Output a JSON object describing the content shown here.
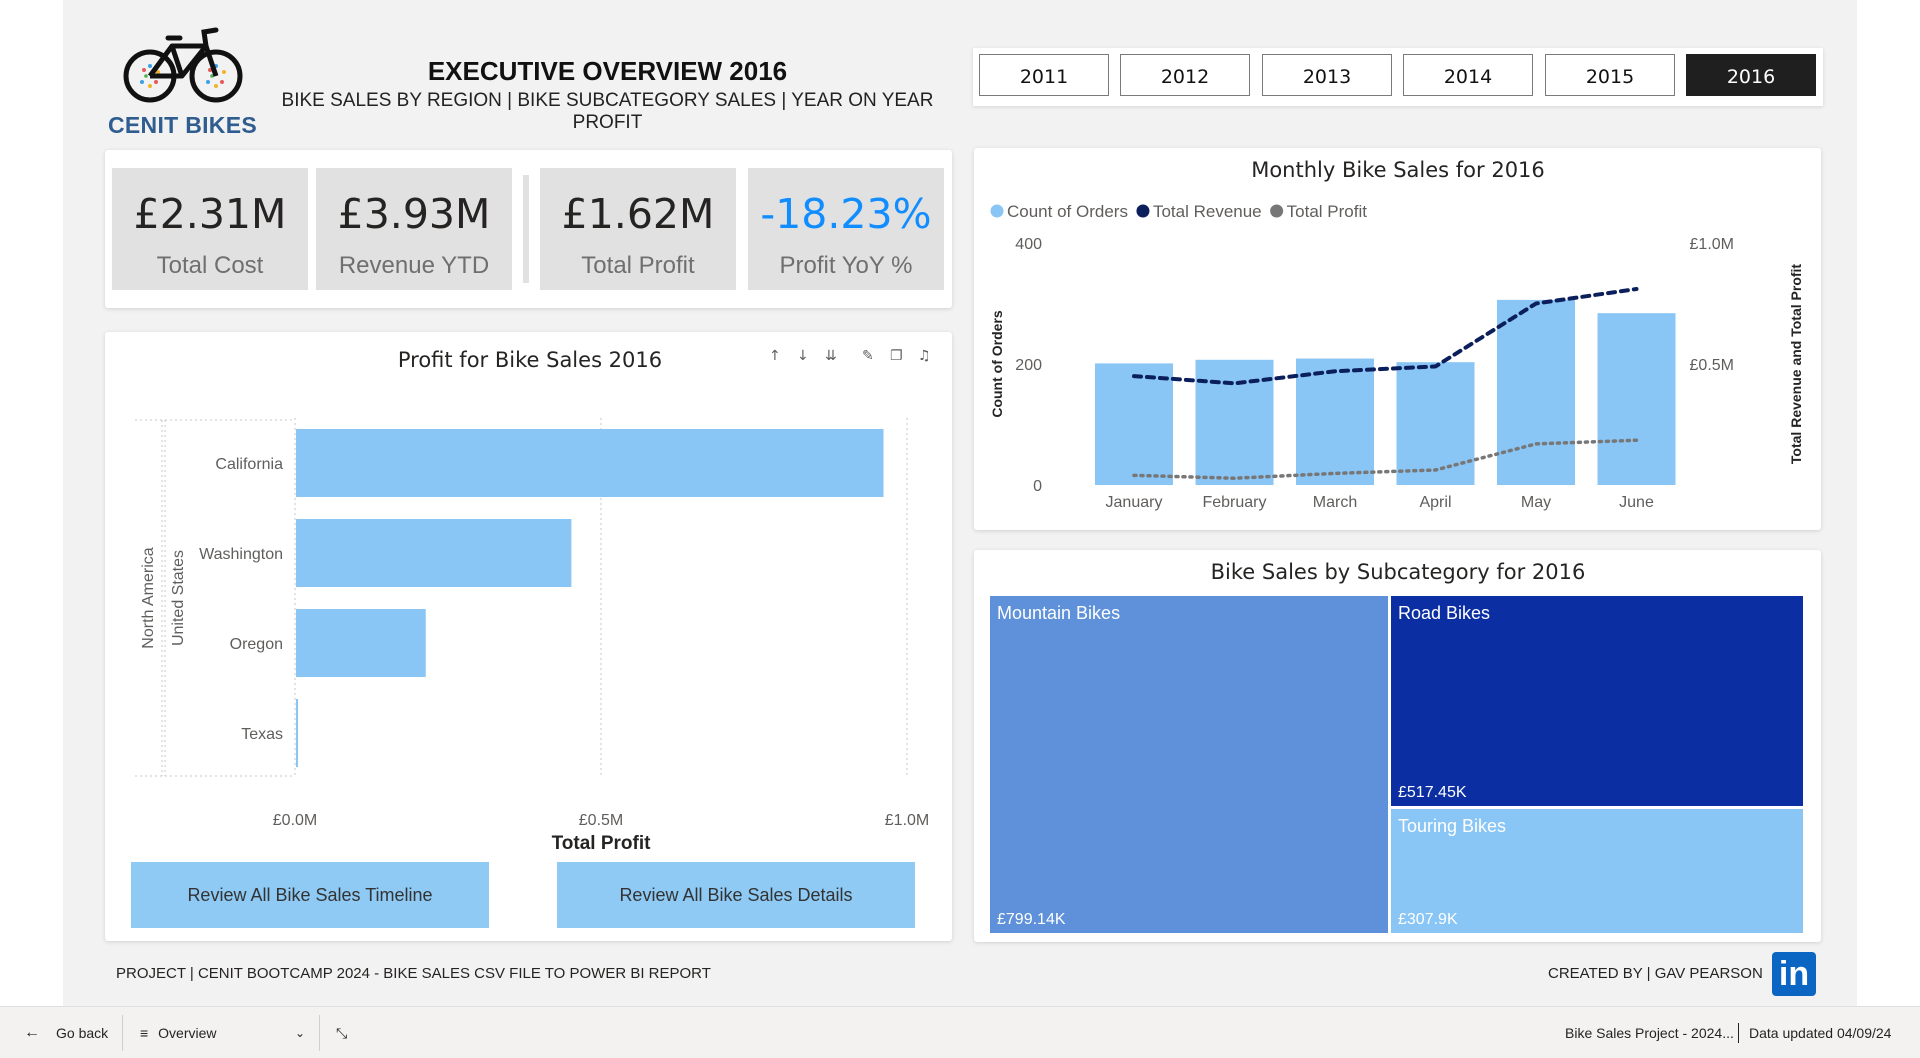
{
  "header": {
    "logo_text": "CENIT BIKES",
    "title": "EXECUTIVE OVERVIEW 2016",
    "subtitle": "BIKE SALES BY REGION | BIKE SUBCATEGORY SALES | YEAR ON YEAR PROFIT"
  },
  "years": {
    "items": [
      "2011",
      "2012",
      "2013",
      "2014",
      "2015",
      "2016"
    ],
    "selected": "2016"
  },
  "kpis": [
    {
      "value": "£2.31M",
      "label": "Total Cost"
    },
    {
      "value": "£3.93M",
      "label": "Revenue YTD"
    },
    {
      "value": "£1.62M",
      "label": "Total Profit"
    },
    {
      "value": "-18.23%",
      "label": "Profit YoY %",
      "color": "#118dff"
    }
  ],
  "profit_chart": {
    "title": "Profit for Bike Sales 2016",
    "toolbar_icons": [
      "arrow-up-icon",
      "arrow-down-icon",
      "expand-hierarchy-icon",
      "pin-icon",
      "copy-icon",
      "bell-icon"
    ],
    "outer_group": "North America",
    "inner_group": "United States",
    "chart_data": {
      "type": "bar",
      "orientation": "horizontal",
      "categories": [
        "California",
        "Washington",
        "Oregon",
        "Texas"
      ],
      "values": [
        960000,
        450000,
        212000,
        2000
      ],
      "xlabel": "Total Profit",
      "xlim": [
        0,
        1000000
      ],
      "x_ticks": [
        "£0.0M",
        "£0.5M",
        "£1.0M"
      ],
      "color": "#89c5f5"
    }
  },
  "buttons": {
    "timeline": "Review All Bike Sales Timeline",
    "details": "Review All Bike Sales Details"
  },
  "monthly_chart": {
    "title": "Monthly Bike Sales for 2016",
    "chart_data": {
      "type": "bar",
      "categories": [
        "January",
        "February",
        "March",
        "April",
        "May",
        "June"
      ],
      "series": [
        {
          "name": "Count of Orders",
          "type": "bar",
          "axis": "left",
          "color": "#89c5f5",
          "values": [
            201,
            207,
            209,
            203,
            306,
            284
          ]
        },
        {
          "name": "Total Revenue",
          "type": "line",
          "axis": "right",
          "style": "dashed",
          "color": "#0b1f5c",
          "values": [
            450000,
            420000,
            470000,
            490000,
            750000,
            810000
          ]
        },
        {
          "name": "Total Profit",
          "type": "line",
          "axis": "right",
          "style": "dotted",
          "color": "#777777",
          "values": [
            40000,
            28000,
            48000,
            62000,
            170000,
            185000
          ]
        }
      ],
      "ylabel_left": "Count of Orders",
      "ylabel_right": "Total Revenue and Total Profit",
      "ylim_left": [
        0,
        400
      ],
      "ylim_right": [
        0,
        1000000
      ],
      "left_ticks": [
        "0",
        "200",
        "400"
      ],
      "right_ticks": [
        "£0.5M",
        "£1.0M"
      ],
      "legend_position": "top-left"
    }
  },
  "treemap": {
    "title": "Bike Sales by Subcategory for 2016",
    "chart_data": {
      "type": "treemap",
      "items": [
        {
          "name": "Mountain Bikes",
          "value": 799140,
          "label": "£799.14K",
          "color": "#5e91d9"
        },
        {
          "name": "Road Bikes",
          "value": 517450,
          "label": "£517.45K",
          "color": "#0b2ea3"
        },
        {
          "name": "Touring Bikes",
          "value": 307900,
          "label": "£307.9K",
          "color": "#89c5f5"
        }
      ]
    }
  },
  "footer": {
    "project": "PROJECT | CENIT BOOTCAMP 2024 - BIKE SALES CSV FILE TO POWER BI REPORT",
    "created_by": "CREATED BY | GAV PEARSON",
    "linkedin_text": "in"
  },
  "bottom_bar": {
    "go_back": "Go back",
    "page": "Overview",
    "report_name": "Bike Sales Project - 2024...",
    "data_updated": "Data updated 04/09/24"
  }
}
